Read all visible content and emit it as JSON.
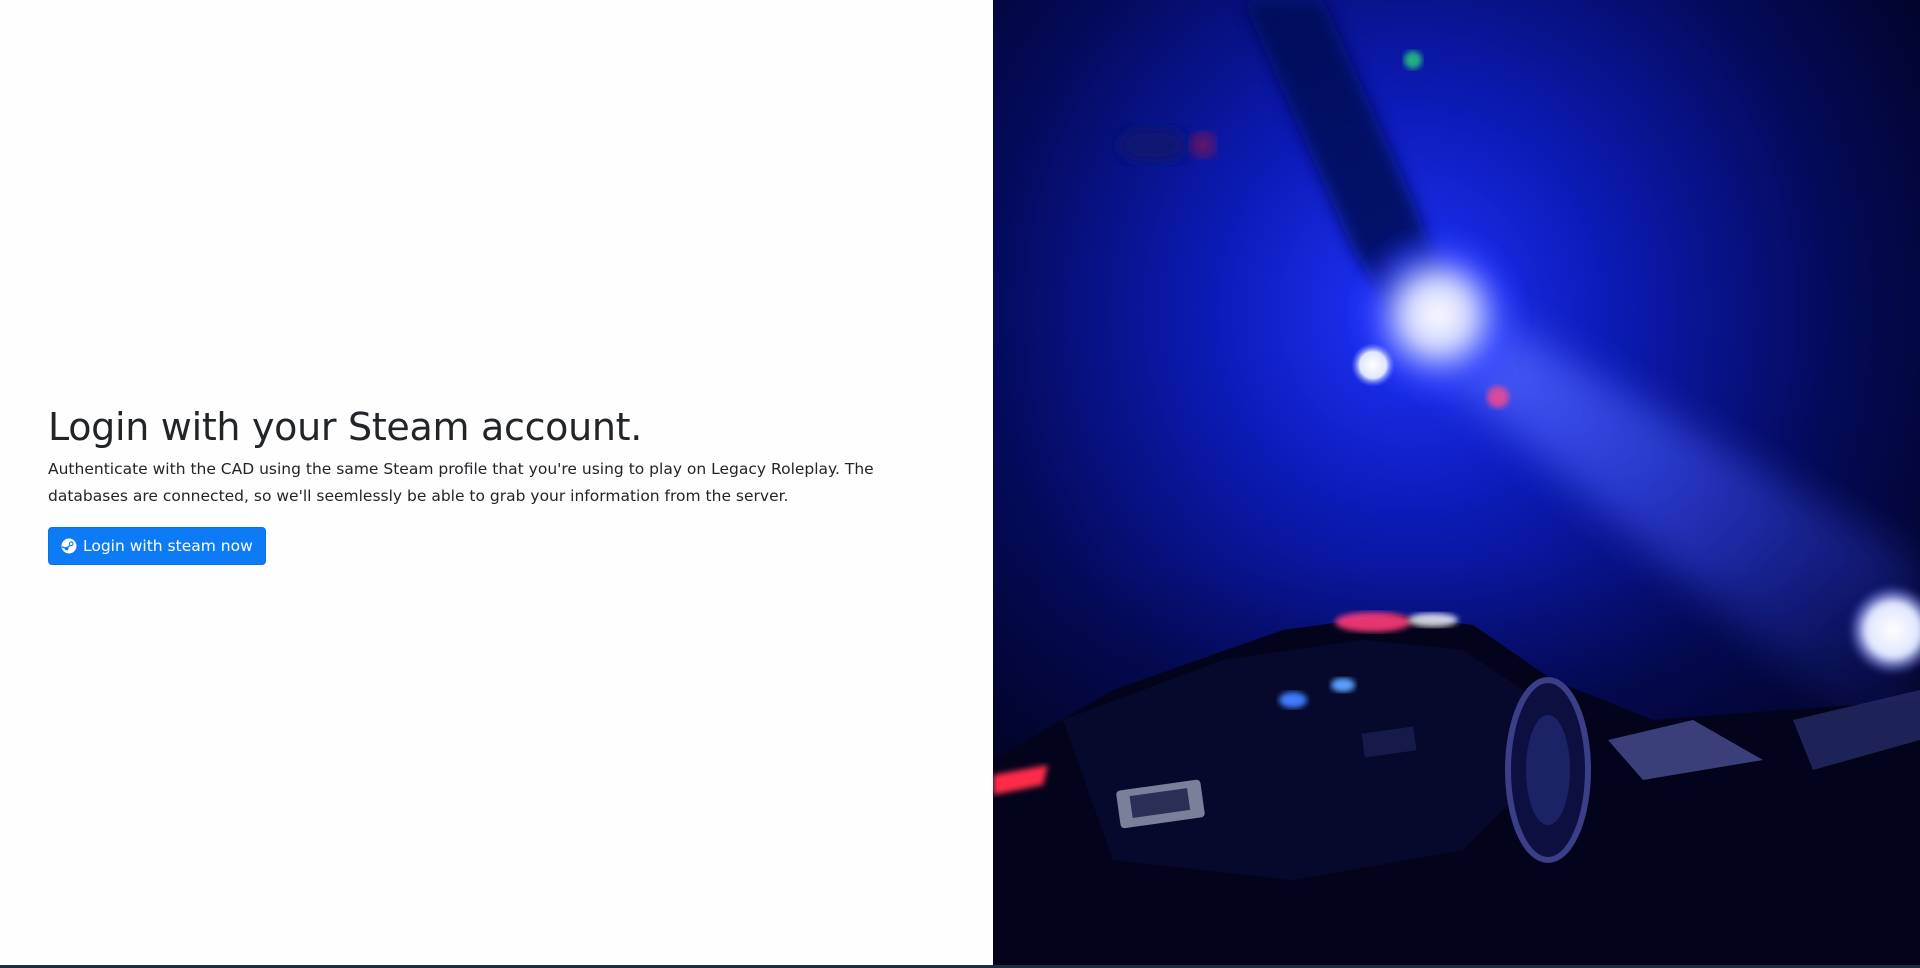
{
  "login": {
    "title": "Login with your Steam account.",
    "description": "Authenticate with the CAD using the same Steam profile that you're using to play on Legacy Roleplay. The databases are connected, so we'll seemlessly be able to grab your information from the server.",
    "button_label": "Login with steam now",
    "button_icon": "steam-icon"
  },
  "colors": {
    "button_bg": "#0d7bf5",
    "text": "#212529",
    "hero_bg": "#02031a",
    "hero_light": "#1f3dff"
  },
  "hero": {
    "icon": "police-car-image"
  }
}
